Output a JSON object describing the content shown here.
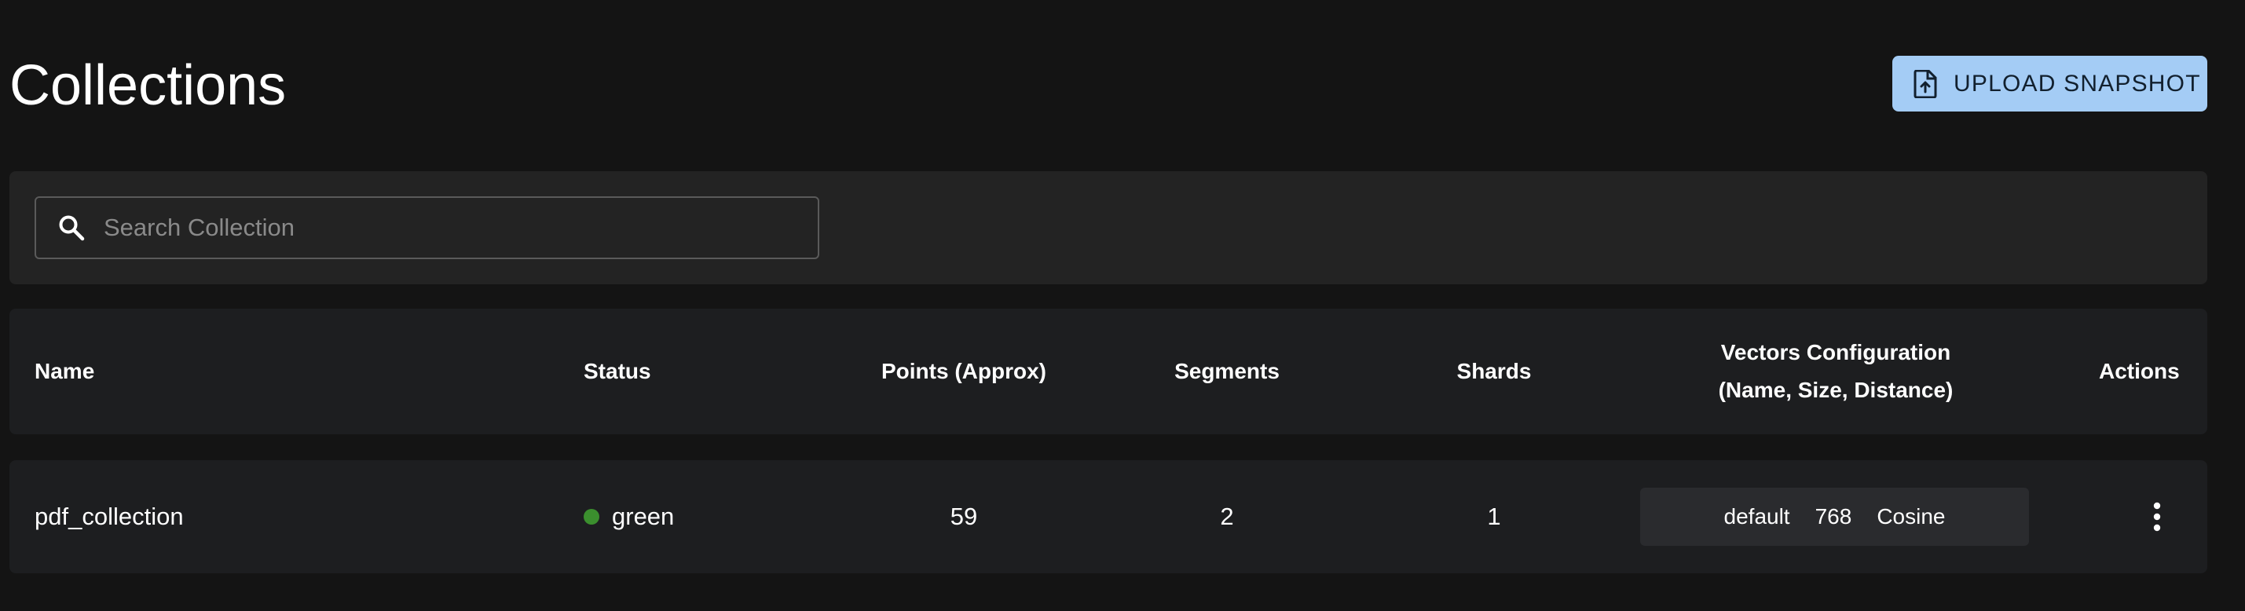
{
  "header": {
    "title": "Collections",
    "upload_button_label": "UPLOAD SNAPSHOT",
    "upload_icon": "file-upload-icon"
  },
  "search": {
    "placeholder": "Search Collection",
    "value": "",
    "icon": "search-icon"
  },
  "table": {
    "columns": {
      "name": "Name",
      "status": "Status",
      "points": "Points (Approx)",
      "segments": "Segments",
      "shards": "Shards",
      "vectors_line1": "Vectors Configuration",
      "vectors_line2": "(Name, Size, Distance)",
      "actions": "Actions"
    },
    "rows": [
      {
        "name": "pdf_collection",
        "status": "green",
        "status_color": "#3b8f2e",
        "points": "59",
        "segments": "2",
        "shards": "1",
        "vector_name": "default",
        "vector_size": "768",
        "vector_distance": "Cosine",
        "actions_icon": "more-vertical-icon"
      }
    ]
  },
  "colors": {
    "background": "#141414",
    "card": "#232323",
    "table_surface": "#1d1e20",
    "accent_button": "#a4ccf5"
  }
}
